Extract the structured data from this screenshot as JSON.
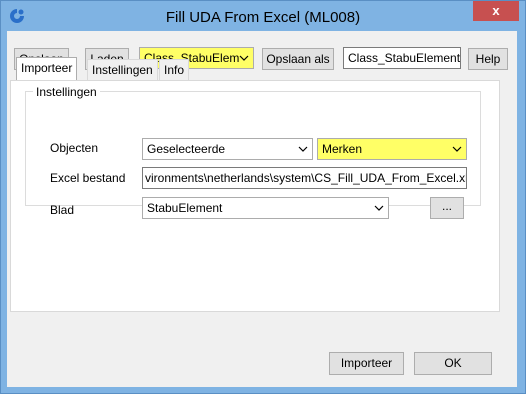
{
  "window": {
    "title": "Fill UDA From Excel (ML008)",
    "close_glyph": "x"
  },
  "toolbar": {
    "save_label": "Opslaan",
    "load_label": "Laden",
    "config_select_value": "Class_StabuElem­",
    "save_as_label": "Opslaan als",
    "save_as_name_value": "Class_StabuElement",
    "help_label": "Help"
  },
  "tabs": [
    {
      "label": "Importeer",
      "active": true
    },
    {
      "label": "Instellingen",
      "active": false
    },
    {
      "label": "Info",
      "active": false
    }
  ],
  "group": {
    "title": "Instellingen",
    "objects_label": "Objecten",
    "objects_value": "Geselecteerde",
    "marks_value": "Merken",
    "excel_label": "Excel bestand",
    "excel_value": "vironments\\netherlands\\system\\CS_Fill_UDA_From_Excel.xlsx",
    "sheet_label": "Blad",
    "sheet_value": "StabuElement",
    "browse_label": "..."
  },
  "footer": {
    "import_label": "Importeer",
    "ok_label": "OK"
  },
  "colors": {
    "titlebar": "#7fb3e3",
    "highlight_yellow": "#ffff66",
    "close_red": "#c75050"
  },
  "icons": {
    "app_icon": "tekla-logo-icon",
    "dropdown": "chevron-down-icon"
  }
}
